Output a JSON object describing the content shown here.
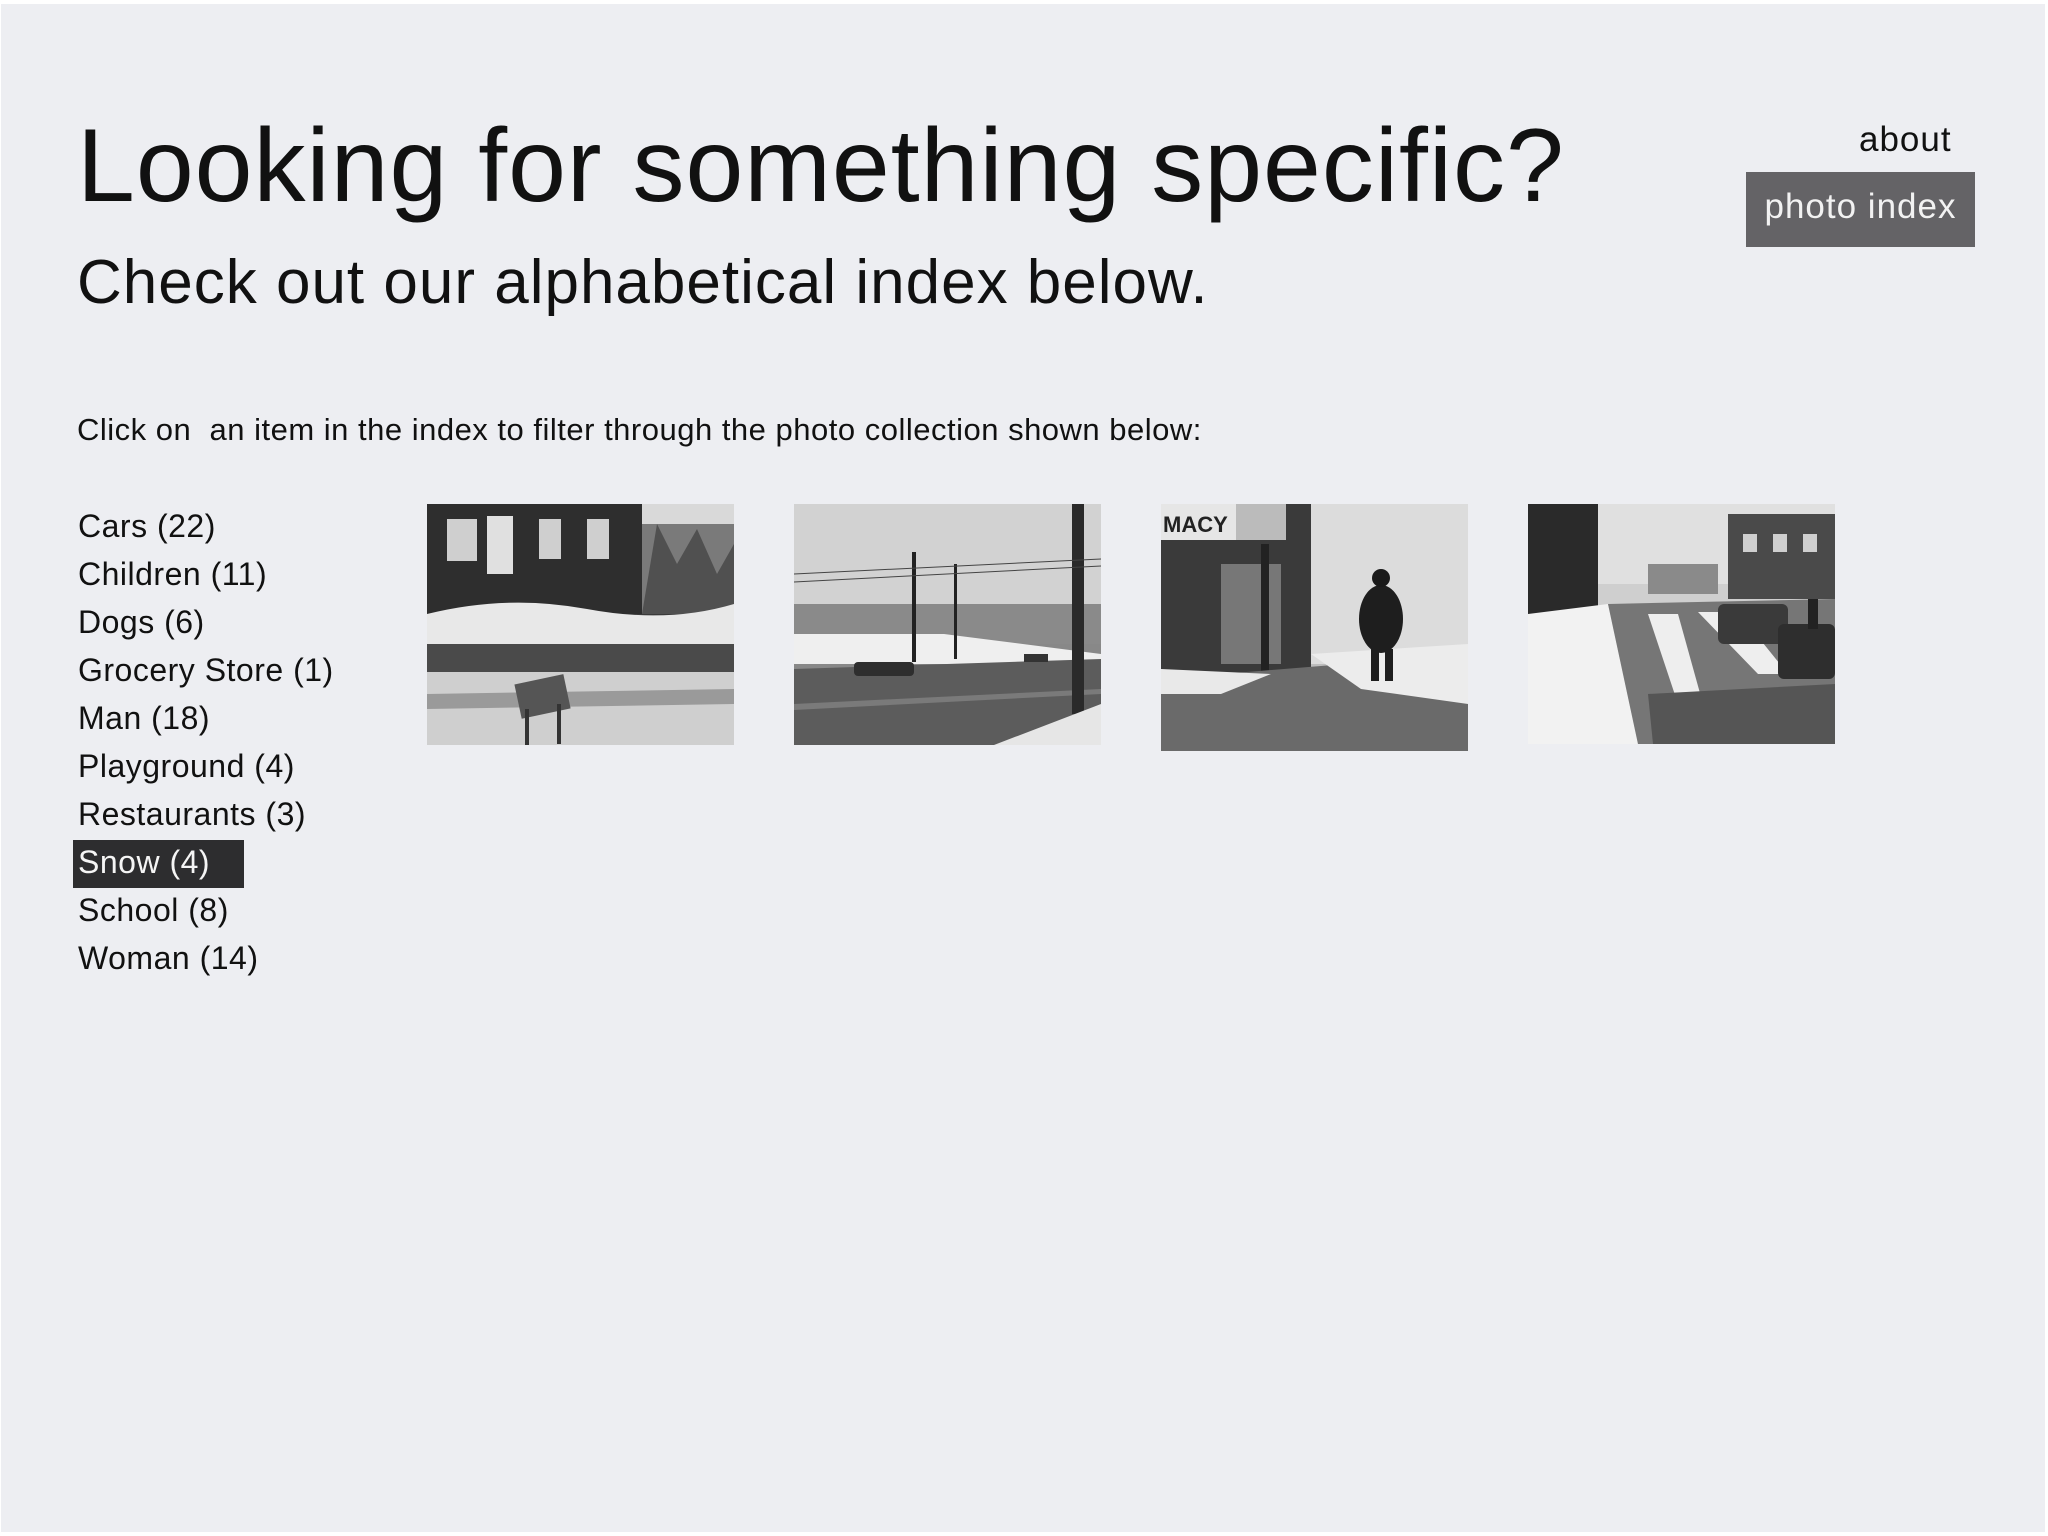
{
  "header": {
    "headline": "Looking for something specific?",
    "subheadline": "Check out our alphabetical index below."
  },
  "nav": {
    "about_label": "about",
    "photo_index_label": "photo index",
    "active": "photo index"
  },
  "instruction": "Click on  an item in the index to filter through the photo collection shown below:",
  "index": {
    "items": [
      {
        "label": "Cars (22)"
      },
      {
        "label": "Children (11)"
      },
      {
        "label": "Dogs (6)"
      },
      {
        "label": "Grocery Store (1)"
      },
      {
        "label": "Man (18)"
      },
      {
        "label": "Playground (4)"
      },
      {
        "label": "Restaurants (3)"
      },
      {
        "label": "Snow (4)"
      },
      {
        "label": "School (8)"
      },
      {
        "label": "Woman (14)"
      }
    ],
    "selected": "Snow (4)"
  },
  "photos": [
    {
      "sign_text": ""
    },
    {
      "sign_text": ""
    },
    {
      "sign_text": "MACY"
    },
    {
      "sign_text": ""
    }
  ],
  "colors": {
    "page_background": "#edeef2",
    "nav_active_background": "#646366",
    "index_selected_background": "#2d2d2f"
  }
}
